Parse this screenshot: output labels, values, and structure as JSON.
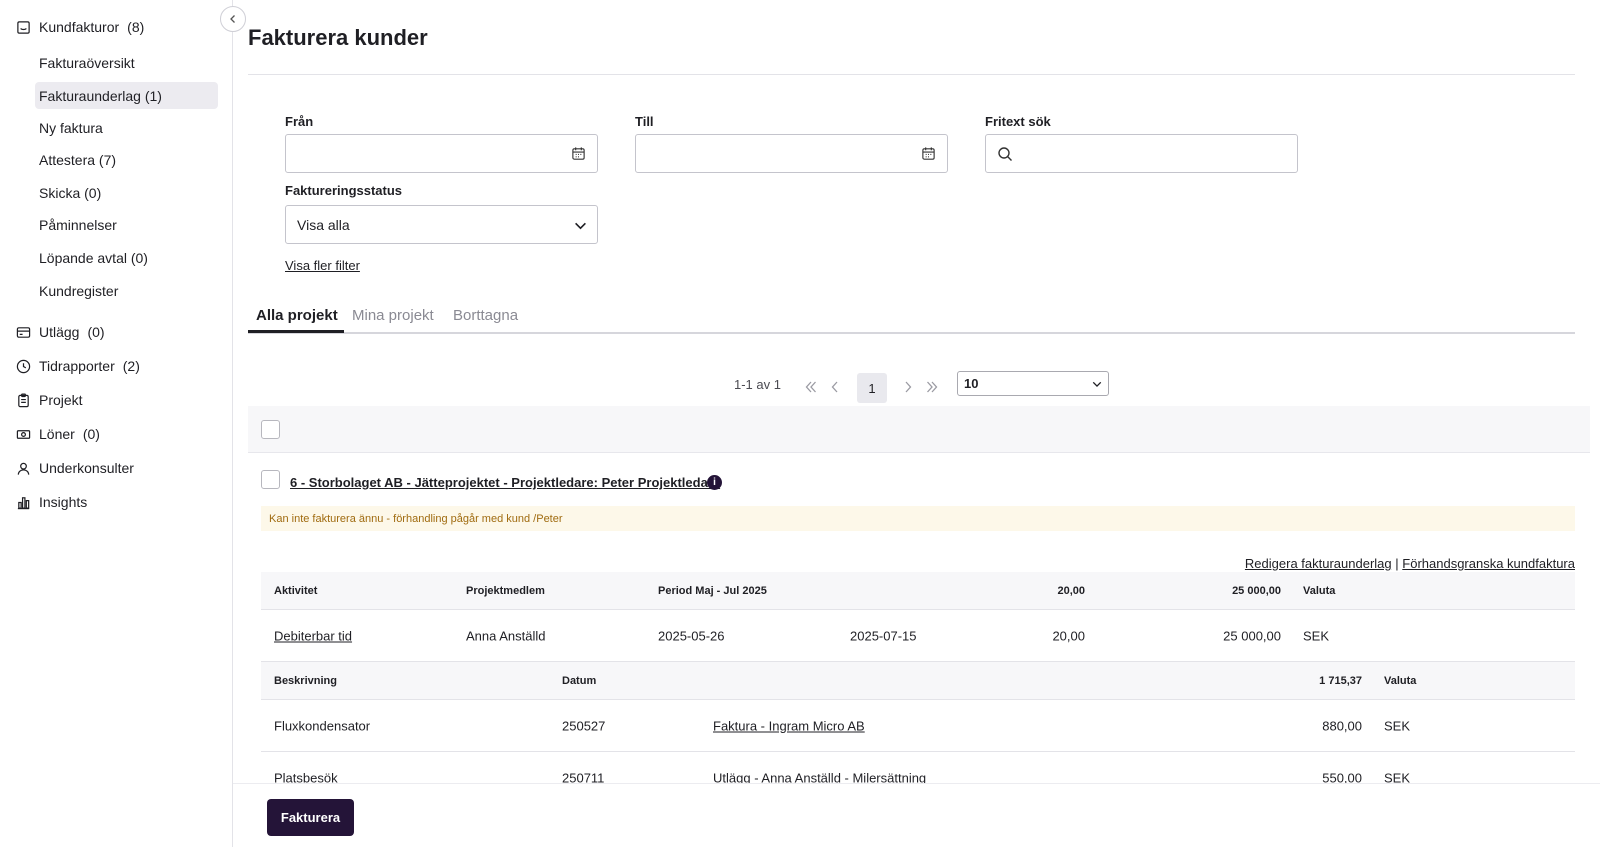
{
  "sidebar": {
    "top_items": [
      {
        "label": "Kundfakturor",
        "count": "(8)"
      },
      {
        "label": "Utlägg",
        "count": "(0)"
      },
      {
        "label": "Tidrapporter",
        "count": "(2)"
      },
      {
        "label": "Projekt",
        "count": ""
      },
      {
        "label": "Löner",
        "count": "(0)"
      },
      {
        "label": "Underkonsulter",
        "count": ""
      },
      {
        "label": "Insights",
        "count": ""
      }
    ],
    "sub_items": [
      {
        "label": "Fakturaöversikt"
      },
      {
        "label": "Fakturaunderlag (1)"
      },
      {
        "label": "Ny faktura"
      },
      {
        "label": "Attestera (7)"
      },
      {
        "label": "Skicka (0)"
      },
      {
        "label": "Påminnelser"
      },
      {
        "label": "Löpande avtal (0)"
      },
      {
        "label": "Kundregister"
      }
    ]
  },
  "page": {
    "title": "Fakturera kunder"
  },
  "filters": {
    "from_label": "Från",
    "to_label": "Till",
    "search_label": "Fritext sök",
    "status_label": "Faktureringsstatus",
    "status_value": "Visa alla",
    "more_filters": "Visa fler filter"
  },
  "tabs": [
    {
      "label": "Alla projekt",
      "active": true
    },
    {
      "label": "Mina projekt",
      "active": false
    },
    {
      "label": "Borttagna",
      "active": false
    }
  ],
  "pagination": {
    "info": "1-1 av 1",
    "current_page": "1",
    "page_size": "10"
  },
  "project": {
    "title": "6 - Storbolaget AB - Jätteprojektet - Projektledare: Peter Projektledare",
    "info_icon": "i",
    "warning": "Kan inte fakturera ännu - förhandling pågår med kund /Peter",
    "link_edit": "Redigera fakturaunderlag",
    "link_separator": "|",
    "link_preview": "Förhandsgranska kundfaktura"
  },
  "time_table": {
    "headers": {
      "activity": "Aktivitet",
      "member": "Projektmedlem",
      "period": "Period Maj - Jul 2025",
      "hours": "20,00",
      "amount": "25 000,00",
      "currency": "Valuta"
    },
    "rows": [
      {
        "activity": "Debiterbar tid",
        "member": "Anna Anställd",
        "from": "2025-05-26",
        "to": "2025-07-15",
        "hours": "20,00",
        "amount": "25 000,00",
        "currency": "SEK"
      }
    ]
  },
  "expense_table": {
    "headers": {
      "description": "Beskrivning",
      "date": "Datum",
      "amount": "1 715,37",
      "currency": "Valuta"
    },
    "rows": [
      {
        "description": "Fluxkondensator",
        "date": "250527",
        "source": "Faktura - Ingram Micro AB",
        "amount": "880,00",
        "currency": "SEK"
      },
      {
        "description": "Platsbesök",
        "date": "250711",
        "source": "Utlägg - Anna Anställd - Milersättning",
        "amount": "550,00",
        "currency": "SEK"
      }
    ]
  },
  "footer": {
    "invoice_button": "Fakturera"
  },
  "colors": {
    "primary": "#241438",
    "warning_bg": "#fdf8e9",
    "warning_text": "#a06b10"
  }
}
